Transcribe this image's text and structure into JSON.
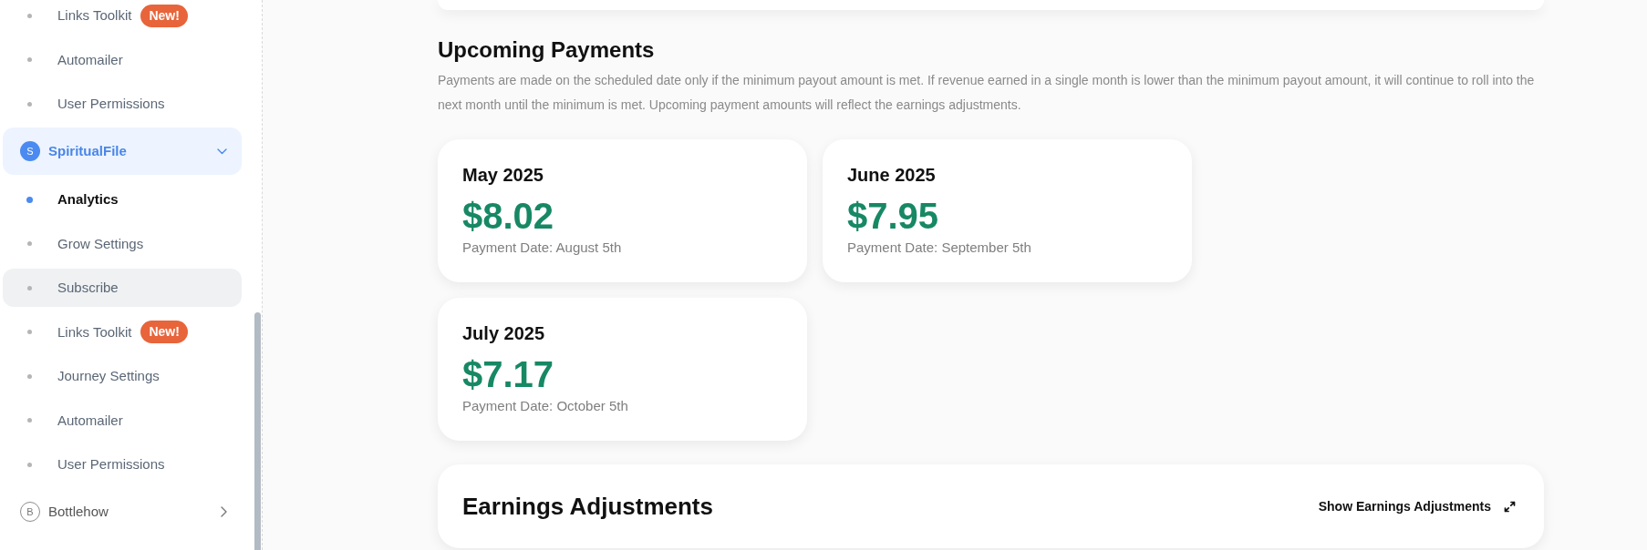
{
  "sidebar": {
    "groups": [
      {
        "children": [
          {
            "label": "Links Toolkit",
            "badge": "New!",
            "selected": false,
            "hovered": false
          },
          {
            "label": "Automailer",
            "selected": false,
            "hovered": false
          },
          {
            "label": "User Permissions",
            "selected": false,
            "hovered": false
          }
        ]
      },
      {
        "label": "SpiritualFile",
        "avatar": "S",
        "selected": true,
        "expanded": true,
        "children": [
          {
            "label": "Analytics",
            "selected": true,
            "hovered": false
          },
          {
            "label": "Grow Settings",
            "selected": false,
            "hovered": false
          },
          {
            "label": "Subscribe",
            "selected": false,
            "hovered": true
          },
          {
            "label": "Links Toolkit",
            "badge": "New!",
            "selected": false,
            "hovered": false
          },
          {
            "label": "Journey Settings",
            "selected": false,
            "hovered": false
          },
          {
            "label": "Automailer",
            "selected": false,
            "hovered": false
          },
          {
            "label": "User Permissions",
            "selected": false,
            "hovered": false
          }
        ]
      },
      {
        "label": "Bottlehow",
        "avatar": "B",
        "selected": false,
        "expanded": false
      }
    ]
  },
  "upcoming_payments": {
    "title": "Upcoming Payments",
    "description": "Payments are made on the scheduled date only if the minimum payout amount is met. If revenue earned in a single month is lower than the minimum payout amount, it will continue to roll into the next month until the minimum is met. Upcoming payment amounts will reflect the earnings adjustments.",
    "payments": [
      {
        "month": "May 2025",
        "amount": "$8.02",
        "payment_date": "Payment Date: August 5th"
      },
      {
        "month": "June 2025",
        "amount": "$7.95",
        "payment_date": "Payment Date: September 5th"
      },
      {
        "month": "July 2025",
        "amount": "$7.17",
        "payment_date": "Payment Date: October 5th"
      }
    ]
  },
  "earnings_adjustments": {
    "title": "Earnings Adjustments",
    "toggle": "Show Earnings Adjustments"
  }
}
